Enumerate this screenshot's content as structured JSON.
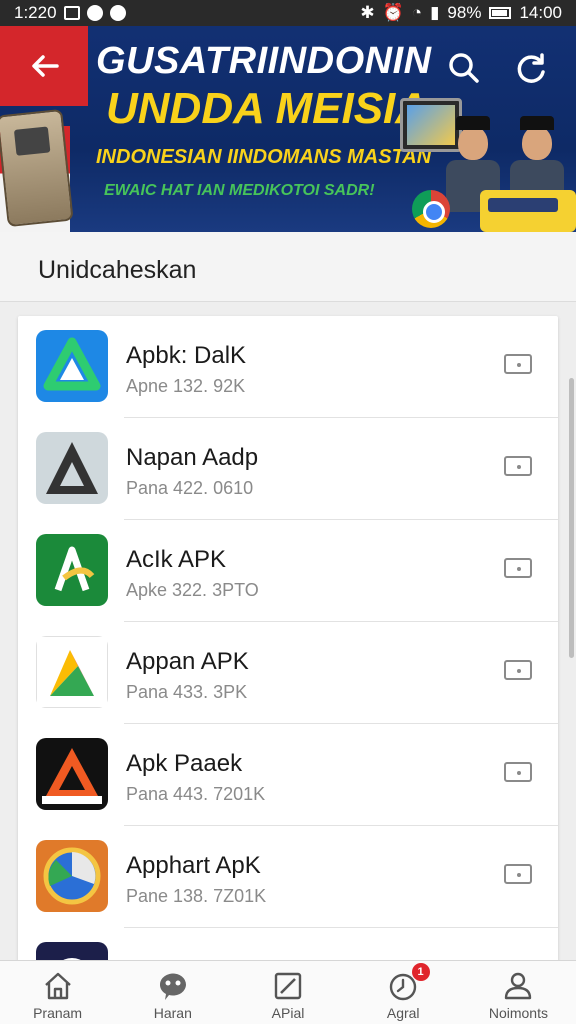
{
  "status_bar": {
    "time_left": "1:220",
    "signal": "98%",
    "time_right": "14:00"
  },
  "banner": {
    "back_icon": "arrow-left-icon",
    "title": "GUSATRIINDONIN",
    "subtitle": "UNDDA MEISIA",
    "line3": "INDONESIAN IINDOMANS MASTAN",
    "line4": "EWAIC HAT IAN MEDIKOTOI SADR!",
    "search_icon": "search-icon",
    "refresh_icon": "refresh-icon",
    "brand_color": "#d4262b",
    "accent_color": "#f9d21b"
  },
  "section": {
    "title": "Unidcaheskan"
  },
  "apps": [
    {
      "name": "Apbk: DalK",
      "meta": "Apne 132. 92K"
    },
    {
      "name": "Napan Aadp",
      "meta": "Pana 422. 0610"
    },
    {
      "name": "AcIk APK",
      "meta": "Apke 322. 3PTO"
    },
    {
      "name": "Appan APK",
      "meta": "Pana 433. 3PK"
    },
    {
      "name": "Apk Paaek",
      "meta": "Pana 443. 7201K"
    },
    {
      "name": "Apphart ApK",
      "meta": "Pane 138. 7Z01K"
    }
  ],
  "bottom_nav": [
    {
      "label": "Pranam",
      "icon": "home-icon"
    },
    {
      "label": "Haran",
      "icon": "chat-icon"
    },
    {
      "label": "APial",
      "icon": "edit-icon"
    },
    {
      "label": "Agral",
      "icon": "clock-icon",
      "badge": "1"
    },
    {
      "label": "Noimonts",
      "icon": "person-icon"
    }
  ]
}
